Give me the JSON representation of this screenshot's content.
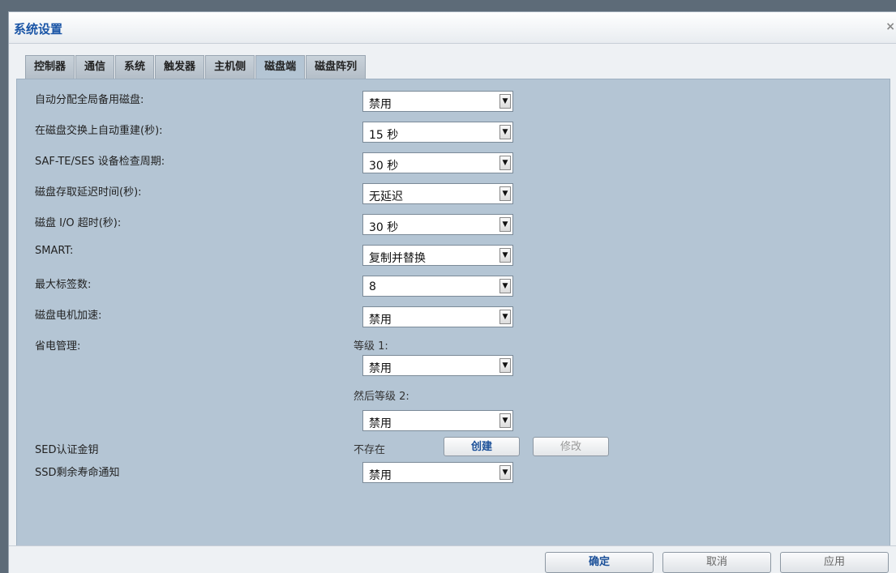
{
  "window": {
    "title": "系统设置",
    "close_icon": "×"
  },
  "tabs": [
    {
      "label": "控制器",
      "active": false
    },
    {
      "label": "通信",
      "active": false
    },
    {
      "label": "系统",
      "active": false
    },
    {
      "label": "触发器",
      "active": false
    },
    {
      "label": "主机侧",
      "active": false
    },
    {
      "label": "磁盘端",
      "active": true
    },
    {
      "label": "磁盘阵列",
      "active": false
    }
  ],
  "settings": {
    "auto_assign_spare": {
      "label": "自动分配全局备用磁盘:",
      "value": "禁用"
    },
    "auto_rebuild": {
      "label": "在磁盘交换上自动重建(秒):",
      "value": "15 秒"
    },
    "saf_te_ses": {
      "label": "SAF-TE/SES 设备检查周期:",
      "value": "30 秒"
    },
    "access_delay": {
      "label": "磁盘存取延迟时间(秒):",
      "value": "无延迟"
    },
    "io_timeout": {
      "label": "磁盘 I/O 超时(秒):",
      "value": "30 秒"
    },
    "smart": {
      "label": "SMART:",
      "value": "复制并替换"
    },
    "max_tags": {
      "label": "最大标签数:",
      "value": "8"
    },
    "spinup": {
      "label": "磁盘电机加速:",
      "value": "禁用"
    },
    "power_mgmt": {
      "label": "省电管理:",
      "level1_label": "等级 1:",
      "level1_value": "禁用",
      "level2_label": "然后等级 2:",
      "level2_value": "禁用"
    },
    "sed_key": {
      "label": "SED认证金钥",
      "status": "不存在",
      "create_label": "创建",
      "modify_label": "修改"
    },
    "ssd_life": {
      "label": "SSD剩余寿命通知",
      "value": "禁用"
    }
  },
  "footer": {
    "ok_label": "确定",
    "cancel_label": "取消",
    "apply_label": "应用"
  },
  "icons": {
    "dropdown": "▼"
  }
}
